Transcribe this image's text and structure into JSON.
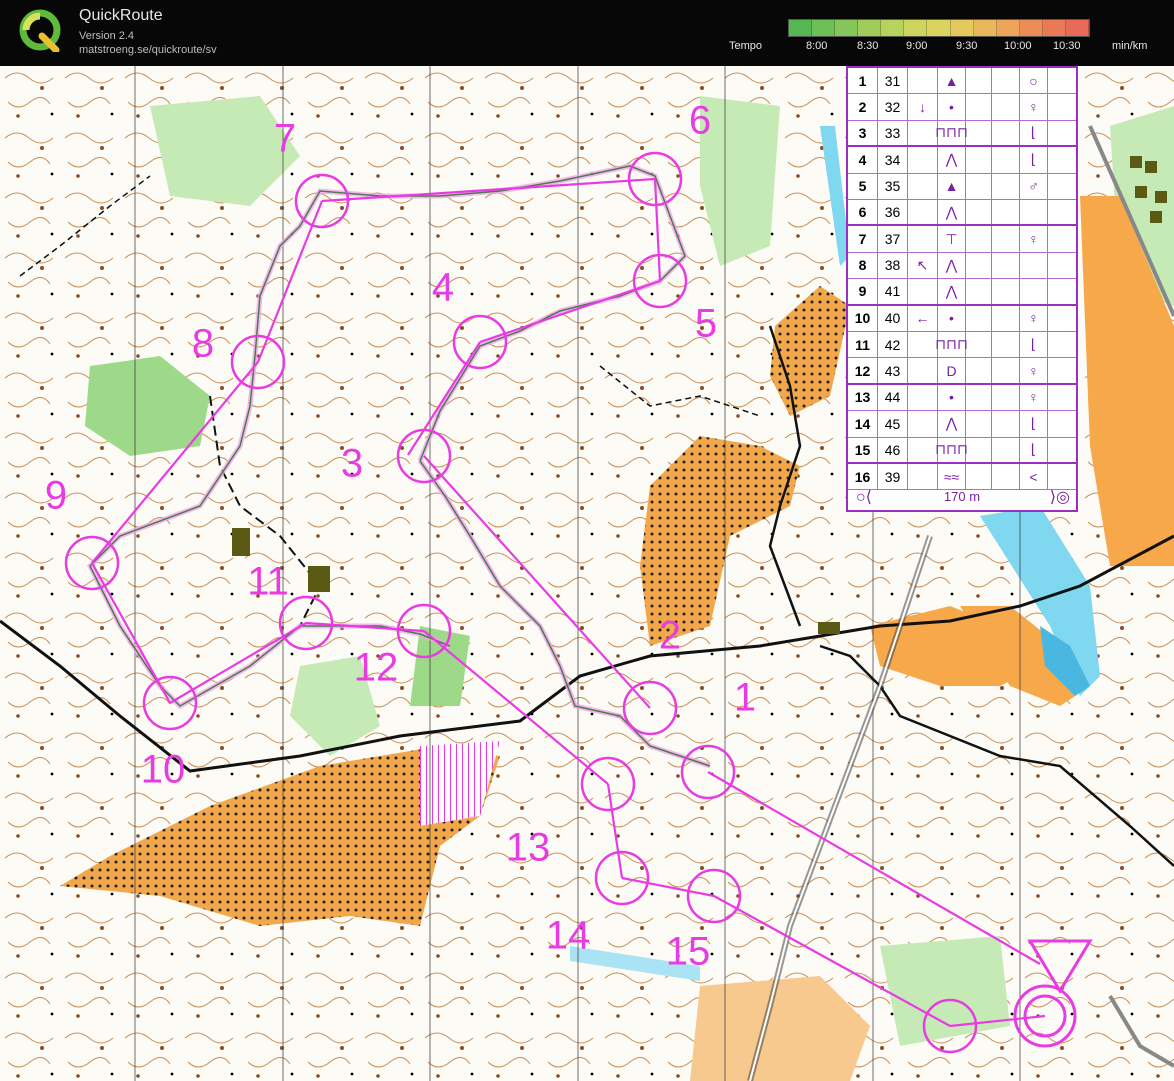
{
  "app": {
    "title": "QuickRoute",
    "version": "Version 2.4",
    "url": "matstroeng.se/quickroute/sv"
  },
  "tempo": {
    "label": "Tempo",
    "ticks": [
      "8:00",
      "8:30",
      "9:00",
      "9:30",
      "10:00",
      "10:30"
    ],
    "unit": "min/km",
    "colors": [
      "#56b854",
      "#6fbf57",
      "#86c55a",
      "#a0cc5c",
      "#b8d25e",
      "#cdd55f",
      "#dcd35f",
      "#e6c95e",
      "#eab85c",
      "#eca35a",
      "#ec8d58",
      "#ea7a57",
      "#e86a58"
    ]
  },
  "colors": {
    "course": "#e83be3",
    "route": "#4a7a4e",
    "route_highlight": "#f0a2ea",
    "open_land": "#f6a84a",
    "green_vegetation": "#9ed98a",
    "water": "#7fd7f0",
    "description_border": "#9a2fc1"
  },
  "control_labels": [
    "1",
    "2",
    "3",
    "4",
    "5",
    "6",
    "7",
    "8",
    "9",
    "10",
    "11",
    "12",
    "13",
    "14",
    "15"
  ],
  "description_card": {
    "rows": [
      {
        "num": "1",
        "code": "31",
        "c": "",
        "d": "▲",
        "e": "",
        "f": "",
        "g": "○",
        "h": ""
      },
      {
        "num": "2",
        "code": "32",
        "c": "↓",
        "d": "•",
        "e": "",
        "f": "",
        "g": "♀",
        "h": ""
      },
      {
        "num": "3",
        "code": "33",
        "c": "",
        "d": "⊓⊓⊓",
        "e": "",
        "f": "",
        "g": "⌊",
        "h": ""
      },
      {
        "num": "4",
        "code": "34",
        "c": "",
        "d": "⋀",
        "e": "",
        "f": "",
        "g": "⌊",
        "h": ""
      },
      {
        "num": "5",
        "code": "35",
        "c": "",
        "d": "▲",
        "e": "",
        "f": "",
        "g": "♂",
        "h": ""
      },
      {
        "num": "6",
        "code": "36",
        "c": "",
        "d": "⋀",
        "e": "",
        "f": "",
        "g": "",
        "h": ""
      },
      {
        "num": "7",
        "code": "37",
        "c": "",
        "d": "⊤",
        "e": "",
        "f": "",
        "g": "♀",
        "h": ""
      },
      {
        "num": "8",
        "code": "38",
        "c": "↖",
        "d": "⋀",
        "e": "",
        "f": "",
        "g": "",
        "h": ""
      },
      {
        "num": "9",
        "code": "41",
        "c": "",
        "d": "⋀",
        "e": "",
        "f": "",
        "g": "",
        "h": ""
      },
      {
        "num": "10",
        "code": "40",
        "c": "←",
        "d": "•",
        "e": "",
        "f": "",
        "g": "♀",
        "h": ""
      },
      {
        "num": "11",
        "code": "42",
        "c": "",
        "d": "⊓⊓⊓",
        "e": "",
        "f": "",
        "g": "⌊",
        "h": ""
      },
      {
        "num": "12",
        "code": "43",
        "c": "",
        "d": "D",
        "e": "",
        "f": "",
        "g": "♀",
        "h": ""
      },
      {
        "num": "13",
        "code": "44",
        "c": "",
        "d": "•",
        "e": "",
        "f": "",
        "g": "♀",
        "h": ""
      },
      {
        "num": "14",
        "code": "45",
        "c": "",
        "d": "⋀",
        "e": "",
        "f": "",
        "g": "⌊",
        "h": ""
      },
      {
        "num": "15",
        "code": "46",
        "c": "",
        "d": "⊓⊓⊓",
        "e": "",
        "f": "",
        "g": "⌊",
        "h": ""
      },
      {
        "num": "16",
        "code": "39",
        "c": "",
        "d": "≈≈",
        "e": "",
        "f": "",
        "g": "<",
        "h": ""
      }
    ],
    "footer_distance": "170 m"
  }
}
